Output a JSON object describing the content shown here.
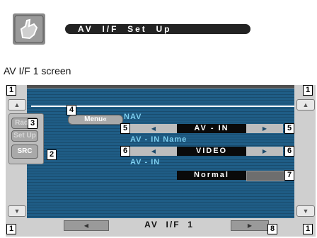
{
  "header": {
    "title": "AV  I/F  Set  Up",
    "icon": "hand-pointer-icon"
  },
  "caption": "AV I/F 1 screen",
  "left_panel": {
    "radio": "Radio",
    "setup": "Set Up",
    "src": "SRC"
  },
  "menu_label": "Menu«",
  "nav_label": "NAV",
  "rows": {
    "input_value": "AV - IN",
    "name_label": "AV - IN Name",
    "video_value": "VIDEO",
    "sub_label": "AV - IN",
    "normal_value": "Normal"
  },
  "footer": {
    "page_label": "AV  I/F  1"
  },
  "callouts": [
    "1",
    "1",
    "1",
    "1",
    "2",
    "3",
    "4",
    "5",
    "5",
    "6",
    "6",
    "7",
    "8"
  ],
  "colors": {
    "screen_bg": "#1f5d86",
    "label_cyan": "#7fd0f0",
    "field_black": "#0a0a0a"
  }
}
